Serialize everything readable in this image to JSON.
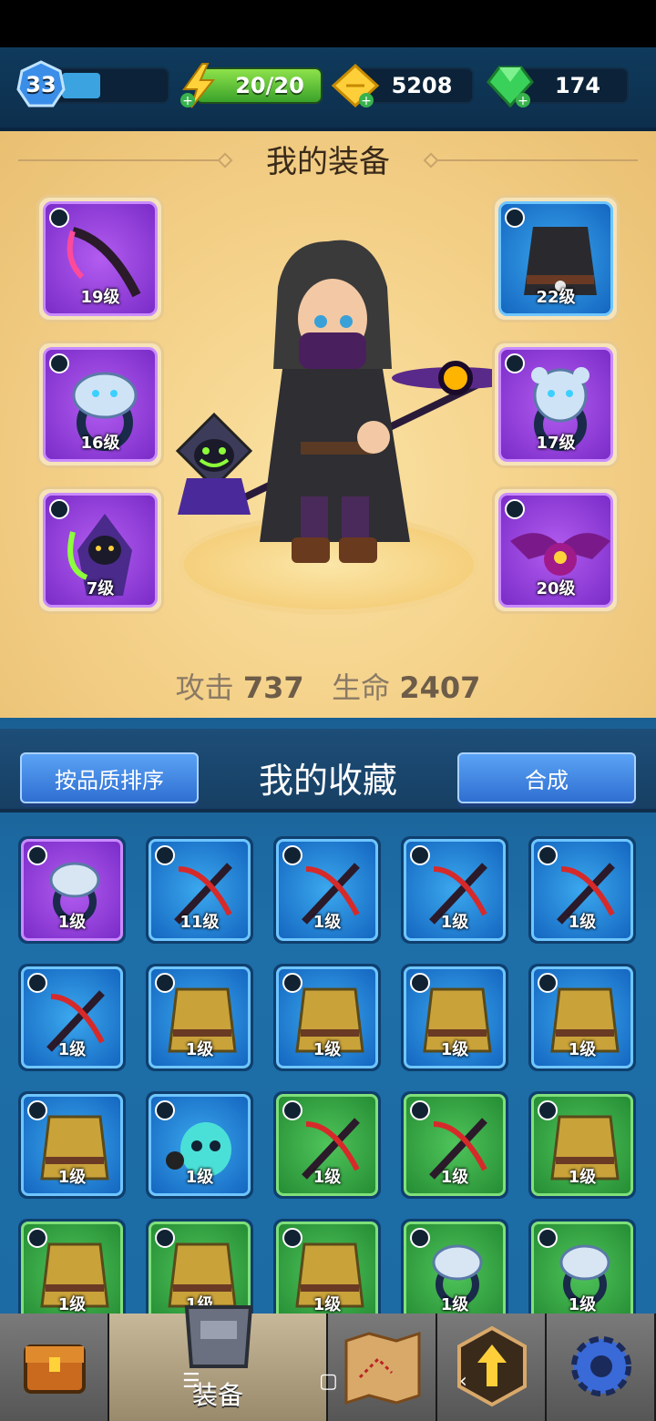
{
  "header": {
    "level": "33",
    "xp_fraction": 0.3,
    "energy": "20/20",
    "gold": "5208",
    "gems": "174"
  },
  "equipment": {
    "title": "我的装备",
    "slots": {
      "left_top": {
        "level": "19级",
        "type": "weapon-icon",
        "rarity": "purple"
      },
      "left_mid": {
        "level": "16级",
        "type": "ring-icon",
        "rarity": "purple"
      },
      "left_bot": {
        "level": "7级",
        "type": "pet-icon",
        "rarity": "purple"
      },
      "right_top": {
        "level": "22级",
        "type": "armor-icon",
        "rarity": "blue"
      },
      "right_mid": {
        "level": "17级",
        "type": "ring-icon",
        "rarity": "purple"
      },
      "right_bot": {
        "level": "20级",
        "type": "pet-icon",
        "rarity": "purple"
      }
    },
    "attack_label": "攻击",
    "attack_value": "737",
    "hp_label": "生命",
    "hp_value": "2407"
  },
  "collection": {
    "title": "我的收藏",
    "sort_button": "按品质排序",
    "merge_button": "合成",
    "items": [
      {
        "level": "1级",
        "rarity": "purple",
        "type": "ring-icon"
      },
      {
        "level": "11级",
        "rarity": "blue",
        "type": "weapon-icon"
      },
      {
        "level": "1级",
        "rarity": "blue",
        "type": "weapon-icon"
      },
      {
        "level": "1级",
        "rarity": "blue",
        "type": "weapon-icon"
      },
      {
        "level": "1级",
        "rarity": "blue",
        "type": "weapon-icon"
      },
      {
        "level": "1级",
        "rarity": "blue",
        "type": "weapon-icon"
      },
      {
        "level": "1级",
        "rarity": "blue",
        "type": "armor-icon"
      },
      {
        "level": "1级",
        "rarity": "blue",
        "type": "armor-icon"
      },
      {
        "level": "1级",
        "rarity": "blue",
        "type": "armor-icon"
      },
      {
        "level": "1级",
        "rarity": "blue",
        "type": "armor-icon"
      },
      {
        "level": "1级",
        "rarity": "blue",
        "type": "armor-icon"
      },
      {
        "level": "1级",
        "rarity": "blue",
        "type": "pet-icon"
      },
      {
        "level": "1级",
        "rarity": "green",
        "type": "weapon-icon"
      },
      {
        "level": "1级",
        "rarity": "green",
        "type": "weapon-icon"
      },
      {
        "level": "1级",
        "rarity": "green",
        "type": "armor-icon"
      },
      {
        "level": "1级",
        "rarity": "green",
        "type": "armor-icon"
      },
      {
        "level": "1级",
        "rarity": "green",
        "type": "armor-icon"
      },
      {
        "level": "1级",
        "rarity": "green",
        "type": "armor-icon"
      },
      {
        "level": "1级",
        "rarity": "green",
        "type": "ring-icon"
      },
      {
        "level": "1级",
        "rarity": "green",
        "type": "ring-icon"
      }
    ]
  },
  "nav": {
    "equip_label": "装备"
  },
  "colors": {
    "purple": "#8a3ad8",
    "blue": "#1f7ad0",
    "green": "#32a03f",
    "panel": "#f3cf86"
  }
}
